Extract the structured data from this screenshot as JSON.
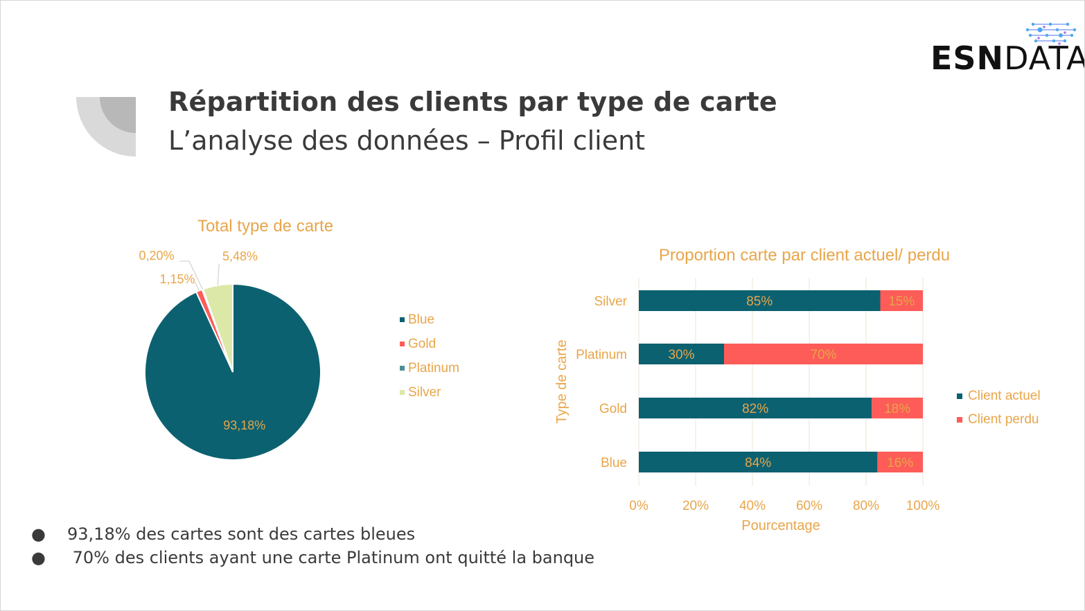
{
  "slide": {
    "title": "Répartition des clients par type de carte",
    "subtitle": "L’analyse des données – Profil client",
    "logo": {
      "bold": "ESN",
      "regular": "DATA"
    },
    "bullets": [
      {
        "dot": "●",
        "text": "93,18%  des cartes sont des cartes bleues"
      },
      {
        "dot": "●",
        "text": " 70% des clients ayant une carte Platinum ont quitté la banque"
      }
    ]
  },
  "colors": {
    "teal": "#0c6170",
    "red": "#fd5c58",
    "slate": "#4f8f94",
    "lightgreen": "#dce8a8",
    "orange": "#e8a54a",
    "text": "#3a3a3a"
  },
  "chart_data": [
    {
      "type": "pie",
      "title": "Total type de carte",
      "categories": [
        "Blue",
        "Gold",
        "Platinum",
        "Silver"
      ],
      "values": [
        93.18,
        1.15,
        0.2,
        5.48
      ],
      "data_labels": [
        "93,18%",
        "1,15%",
        "0,20%",
        "5,48%"
      ],
      "colors": [
        "#0c6170",
        "#fd5c58",
        "#4f8f94",
        "#dce8a8"
      ],
      "legend": "right"
    },
    {
      "type": "bar",
      "orientation": "horizontal",
      "stacked": "percent",
      "title": "Proportion carte par client actuel/ perdu",
      "xlabel": "Pourcentage",
      "ylabel": "Type de carte",
      "categories": [
        "Silver",
        "Platinum",
        "Gold",
        "Blue"
      ],
      "series": [
        {
          "name": "Client actuel",
          "values": [
            85,
            30,
            82,
            84
          ],
          "labels": [
            "85%",
            "30%",
            "82%",
            "84%"
          ],
          "color": "#0c6170"
        },
        {
          "name": "Client perdu",
          "values": [
            15,
            70,
            18,
            16
          ],
          "labels": [
            "15%",
            "70%",
            "18%",
            "16%"
          ],
          "color": "#fd5c58"
        }
      ],
      "xticks": [
        "0%",
        "20%",
        "40%",
        "60%",
        "80%",
        "100%"
      ],
      "xlim": [
        0,
        100
      ],
      "grid": true,
      "legend": "right"
    }
  ]
}
